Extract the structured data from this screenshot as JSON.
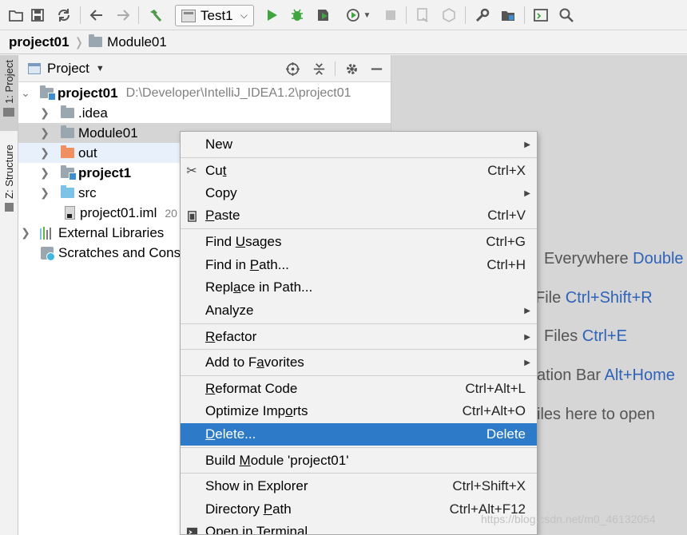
{
  "toolbar": {
    "icons": [
      "open-folder-icon",
      "save-icon",
      "sync-icon",
      "back-arrow-icon",
      "forward-arrow-icon",
      "build-hammer-icon",
      "run-icon",
      "debug-icon",
      "coverage-icon",
      "profile-icon",
      "stop-icon",
      "attach-icon",
      "services-icon",
      "settings-wrench-icon",
      "project-structure-icon",
      "terminal-icon",
      "search-icon"
    ],
    "run_config": "Test1"
  },
  "breadcrumb": {
    "root": "project01",
    "module": "Module01"
  },
  "tool_strip": {
    "project_tab": "1: Project",
    "structure_tab": "Z: Structure"
  },
  "panel": {
    "title": "Project",
    "tree": [
      {
        "name": "project01",
        "path": "D:\\Developer\\IntelliJ_IDEA1.2\\project01"
      },
      {
        "name": ".idea"
      },
      {
        "name": "Module01"
      },
      {
        "name": "out"
      },
      {
        "name": "project1"
      },
      {
        "name": "src"
      },
      {
        "name": "project01.iml",
        "extra": "20"
      },
      {
        "name": "External Libraries"
      },
      {
        "name": "Scratches and Conso"
      }
    ]
  },
  "editor_hints": [
    {
      "text": "Everywhere ",
      "key": "Double"
    },
    {
      "text": "File ",
      "key": "Ctrl+Shift+R"
    },
    {
      "text": "Files ",
      "key": "Ctrl+E"
    },
    {
      "text": "ation Bar ",
      "key": "Alt+Home"
    },
    {
      "text": "iles here to open",
      "key": ""
    }
  ],
  "context_menu": {
    "new": "New",
    "cut": {
      "pre": "Cu",
      "u": "t",
      "post": "",
      "shortcut": "Ctrl+X"
    },
    "copy": "Copy",
    "paste": {
      "pre": "",
      "u": "P",
      "post": "aste",
      "shortcut": "Ctrl+V"
    },
    "find_usages": {
      "pre": "Find ",
      "u": "U",
      "post": "sages",
      "shortcut": "Ctrl+G"
    },
    "find_in_path": {
      "pre": "Find in ",
      "u": "P",
      "post": "ath...",
      "shortcut": "Ctrl+H"
    },
    "replace_in_path": {
      "pre": "Repl",
      "u": "a",
      "post": "ce in Path..."
    },
    "analyze": "Analyze",
    "refactor": {
      "pre": "",
      "u": "R",
      "post": "efactor"
    },
    "add_to_favorites": {
      "pre": "Add to F",
      "u": "a",
      "post": "vorites"
    },
    "reformat_code": {
      "pre": "",
      "u": "R",
      "post": "eformat Code",
      "shortcut": "Ctrl+Alt+L"
    },
    "optimize_imports": {
      "pre": "Optimize Imp",
      "u": "o",
      "post": "rts",
      "shortcut": "Ctrl+Alt+O"
    },
    "delete": {
      "pre": "",
      "u": "D",
      "post": "elete...",
      "shortcut": "Delete"
    },
    "build_module": {
      "pre": "Build ",
      "u": "M",
      "post": "odule 'project01'"
    },
    "show_in_explorer": {
      "label": "Show in Explorer",
      "shortcut": "Ctrl+Shift+X"
    },
    "directory_path": {
      "pre": "Directory ",
      "u": "P",
      "post": "ath",
      "shortcut": "Ctrl+Alt+F12"
    },
    "open_in_terminal": "Open in Terminal"
  },
  "watermark": "https://blog.csdn.net/m0_46132054",
  "colors": {
    "selection": "#2d7bc8",
    "hint_key": "#2f62b9",
    "out_folder": "#f08f60",
    "src_folder": "#7cc3e8"
  }
}
